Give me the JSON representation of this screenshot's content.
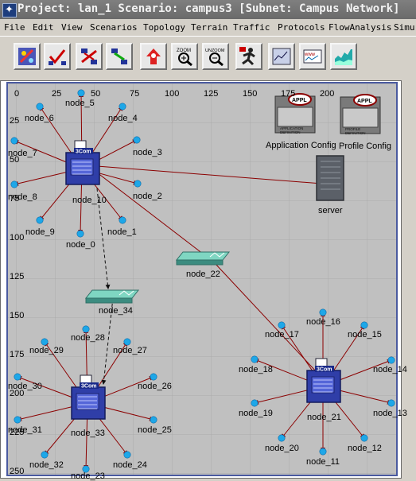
{
  "window": {
    "title": "Project: lan_1 Scenario: campus3 [Subnet: Campus Network]"
  },
  "menu": [
    "File",
    "Edit",
    "View",
    "Scenarios",
    "Topology",
    "Terrain",
    "Traffic",
    "Protocols",
    "FlowAnalysis",
    "Simu"
  ],
  "toolbar": {
    "buttons": [
      {
        "name": "open-palette-button",
        "icon": "palette-icon"
      },
      {
        "name": "check-links-button",
        "icon": "check-links-icon"
      },
      {
        "name": "fail-links-button",
        "icon": "fail-links-icon"
      },
      {
        "name": "recover-links-button",
        "icon": "recover-links-icon"
      },
      {
        "name": "return-parent-button",
        "icon": "up-subnet-icon"
      },
      {
        "name": "zoom-button",
        "icon": "zoom-icon",
        "label": "ZOOM"
      },
      {
        "name": "unzoom-button",
        "icon": "unzoom-icon",
        "label": "UNZOOM"
      },
      {
        "name": "configure-run-button",
        "icon": "run-simulation-icon"
      },
      {
        "name": "view-results-button",
        "icon": "view-results-icon"
      },
      {
        "name": "web-reports-button",
        "icon": "web-reports-icon"
      },
      {
        "name": "view-graph-button",
        "icon": "graph-icon"
      }
    ]
  },
  "ruler": {
    "x": [
      "0",
      "25",
      "50",
      "75",
      "100",
      "125",
      "150",
      "175",
      "200"
    ],
    "y": [
      "25",
      "50",
      "75",
      "100",
      "125",
      "150",
      "175",
      "200",
      "225",
      "250"
    ]
  },
  "nodes": {
    "hub1": "node_10",
    "hub2": "node_33",
    "hub3": "node_21",
    "switch1": "node_34",
    "switch2": "node_22",
    "server": "server",
    "app_config": "Application Config",
    "profile_config": "Profile Config",
    "hub1_clients": [
      "node_5",
      "node_6",
      "node_4",
      "node_7",
      "node_3",
      "node_8",
      "node_2",
      "node_9",
      "node_0",
      "node_1"
    ],
    "hub2_clients": [
      "node_28",
      "node_29",
      "node_27",
      "node_30",
      "node_26",
      "node_31",
      "node_25",
      "node_32",
      "node_23",
      "node_24"
    ],
    "hub3_clients": [
      "node_16",
      "node_17",
      "node_15",
      "node_18",
      "node_14",
      "node_19",
      "node_13",
      "node_20",
      "node_12",
      "node_11"
    ]
  },
  "colors": {
    "link": "#8b0000",
    "client": "#1ea7e8",
    "hub": "#2f3ea8"
  },
  "config_labels": {
    "app": "APPLICATION DEFINITION",
    "profile": "PROFILE DEFINITION",
    "badge": "APPL"
  },
  "device_labels": {
    "hub": "3Com"
  }
}
